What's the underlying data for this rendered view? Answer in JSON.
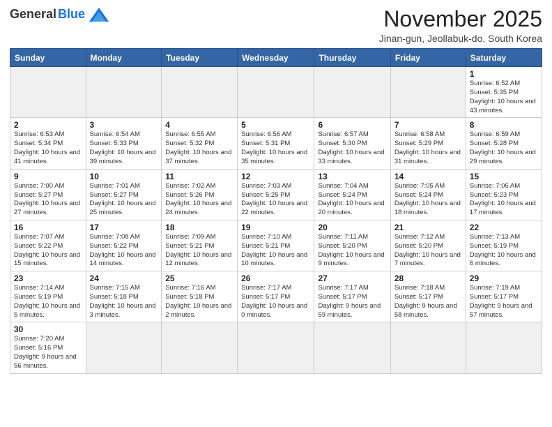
{
  "logo": {
    "general": "General",
    "blue": "Blue"
  },
  "title": "November 2025",
  "subtitle": "Jinan-gun, Jeollabuk-do, South Korea",
  "headers": [
    "Sunday",
    "Monday",
    "Tuesday",
    "Wednesday",
    "Thursday",
    "Friday",
    "Saturday"
  ],
  "weeks": [
    [
      {
        "date": "",
        "info": ""
      },
      {
        "date": "",
        "info": ""
      },
      {
        "date": "",
        "info": ""
      },
      {
        "date": "",
        "info": ""
      },
      {
        "date": "",
        "info": ""
      },
      {
        "date": "",
        "info": ""
      },
      {
        "date": "1",
        "info": "Sunrise: 6:52 AM\nSunset: 5:35 PM\nDaylight: 10 hours and 43 minutes."
      }
    ],
    [
      {
        "date": "2",
        "info": "Sunrise: 6:53 AM\nSunset: 5:34 PM\nDaylight: 10 hours and 41 minutes."
      },
      {
        "date": "3",
        "info": "Sunrise: 6:54 AM\nSunset: 5:33 PM\nDaylight: 10 hours and 39 minutes."
      },
      {
        "date": "4",
        "info": "Sunrise: 6:55 AM\nSunset: 5:32 PM\nDaylight: 10 hours and 37 minutes."
      },
      {
        "date": "5",
        "info": "Sunrise: 6:56 AM\nSunset: 5:31 PM\nDaylight: 10 hours and 35 minutes."
      },
      {
        "date": "6",
        "info": "Sunrise: 6:57 AM\nSunset: 5:30 PM\nDaylight: 10 hours and 33 minutes."
      },
      {
        "date": "7",
        "info": "Sunrise: 6:58 AM\nSunset: 5:29 PM\nDaylight: 10 hours and 31 minutes."
      },
      {
        "date": "8",
        "info": "Sunrise: 6:59 AM\nSunset: 5:28 PM\nDaylight: 10 hours and 29 minutes."
      }
    ],
    [
      {
        "date": "9",
        "info": "Sunrise: 7:00 AM\nSunset: 5:27 PM\nDaylight: 10 hours and 27 minutes."
      },
      {
        "date": "10",
        "info": "Sunrise: 7:01 AM\nSunset: 5:27 PM\nDaylight: 10 hours and 25 minutes."
      },
      {
        "date": "11",
        "info": "Sunrise: 7:02 AM\nSunset: 5:26 PM\nDaylight: 10 hours and 24 minutes."
      },
      {
        "date": "12",
        "info": "Sunrise: 7:03 AM\nSunset: 5:25 PM\nDaylight: 10 hours and 22 minutes."
      },
      {
        "date": "13",
        "info": "Sunrise: 7:04 AM\nSunset: 5:24 PM\nDaylight: 10 hours and 20 minutes."
      },
      {
        "date": "14",
        "info": "Sunrise: 7:05 AM\nSunset: 5:24 PM\nDaylight: 10 hours and 18 minutes."
      },
      {
        "date": "15",
        "info": "Sunrise: 7:06 AM\nSunset: 5:23 PM\nDaylight: 10 hours and 17 minutes."
      }
    ],
    [
      {
        "date": "16",
        "info": "Sunrise: 7:07 AM\nSunset: 5:22 PM\nDaylight: 10 hours and 15 minutes."
      },
      {
        "date": "17",
        "info": "Sunrise: 7:08 AM\nSunset: 5:22 PM\nDaylight: 10 hours and 14 minutes."
      },
      {
        "date": "18",
        "info": "Sunrise: 7:09 AM\nSunset: 5:21 PM\nDaylight: 10 hours and 12 minutes."
      },
      {
        "date": "19",
        "info": "Sunrise: 7:10 AM\nSunset: 5:21 PM\nDaylight: 10 hours and 10 minutes."
      },
      {
        "date": "20",
        "info": "Sunrise: 7:11 AM\nSunset: 5:20 PM\nDaylight: 10 hours and 9 minutes."
      },
      {
        "date": "21",
        "info": "Sunrise: 7:12 AM\nSunset: 5:20 PM\nDaylight: 10 hours and 7 minutes."
      },
      {
        "date": "22",
        "info": "Sunrise: 7:13 AM\nSunset: 5:19 PM\nDaylight: 10 hours and 6 minutes."
      }
    ],
    [
      {
        "date": "23",
        "info": "Sunrise: 7:14 AM\nSunset: 5:19 PM\nDaylight: 10 hours and 5 minutes."
      },
      {
        "date": "24",
        "info": "Sunrise: 7:15 AM\nSunset: 5:18 PM\nDaylight: 10 hours and 3 minutes."
      },
      {
        "date": "25",
        "info": "Sunrise: 7:16 AM\nSunset: 5:18 PM\nDaylight: 10 hours and 2 minutes."
      },
      {
        "date": "26",
        "info": "Sunrise: 7:17 AM\nSunset: 5:17 PM\nDaylight: 10 hours and 0 minutes."
      },
      {
        "date": "27",
        "info": "Sunrise: 7:17 AM\nSunset: 5:17 PM\nDaylight: 9 hours and 59 minutes."
      },
      {
        "date": "28",
        "info": "Sunrise: 7:18 AM\nSunset: 5:17 PM\nDaylight: 9 hours and 58 minutes."
      },
      {
        "date": "29",
        "info": "Sunrise: 7:19 AM\nSunset: 5:17 PM\nDaylight: 9 hours and 57 minutes."
      }
    ],
    [
      {
        "date": "30",
        "info": "Sunrise: 7:20 AM\nSunset: 5:16 PM\nDaylight: 9 hours and 56 minutes."
      },
      {
        "date": "",
        "info": ""
      },
      {
        "date": "",
        "info": ""
      },
      {
        "date": "",
        "info": ""
      },
      {
        "date": "",
        "info": ""
      },
      {
        "date": "",
        "info": ""
      },
      {
        "date": "",
        "info": ""
      }
    ]
  ]
}
